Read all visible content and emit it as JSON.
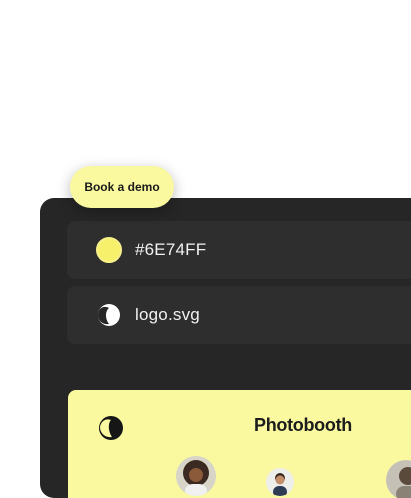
{
  "theme": {
    "accent_color": "#FAF9A0",
    "swatch_color": "#F7F06A"
  },
  "settings": {
    "color_row": {
      "icon": "color-swatch-icon",
      "value": "#6E74FF"
    },
    "logo_row": {
      "icon": "logo-icon",
      "filename": "logo.svg"
    }
  },
  "preview": {
    "brand_name": "Photobooth",
    "cta_label": "Book a demo",
    "avatars": [
      "avatar-woman",
      "avatar-man",
      "avatar-person"
    ]
  }
}
